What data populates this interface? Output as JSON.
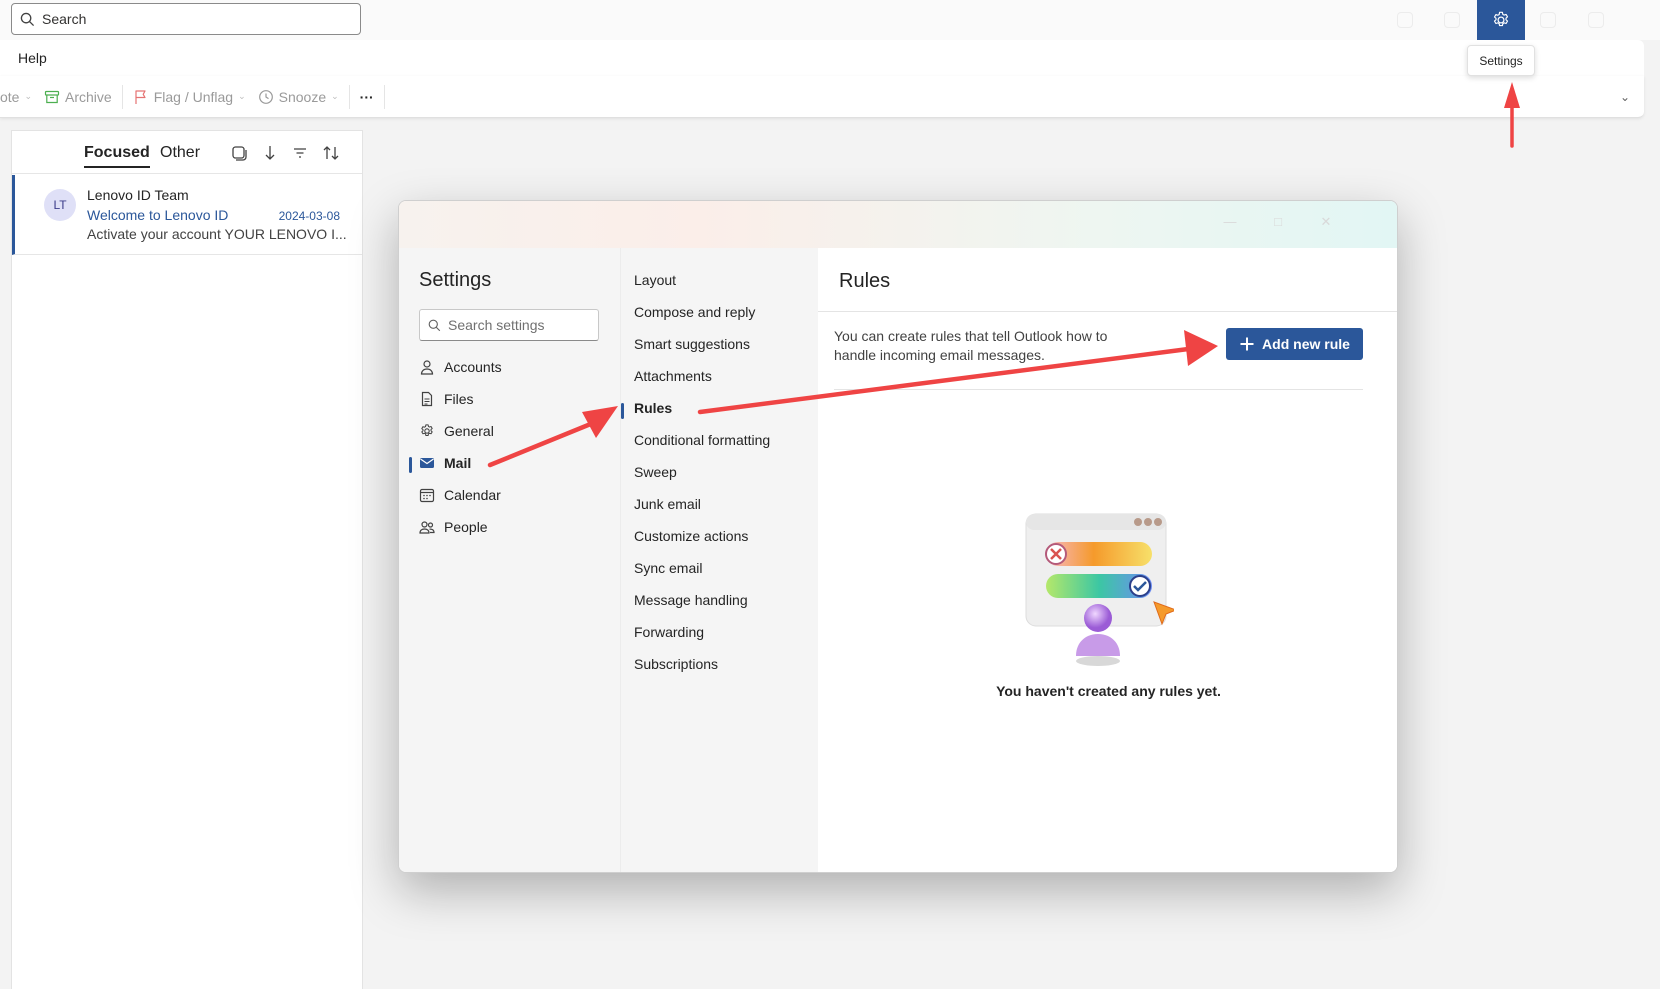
{
  "topbar": {
    "search_placeholder": "Search",
    "settings_icon": "gear-icon"
  },
  "tooltip": {
    "text": "Settings"
  },
  "menubar": {
    "help": "Help"
  },
  "toolbar": {
    "truncated_label": "ote",
    "archive": "Archive",
    "flag": "Flag / Unflag",
    "snooze": "Snooze",
    "more": "···"
  },
  "maillist": {
    "tab_focused": "Focused",
    "tab_other": "Other",
    "message": {
      "initials": "LT",
      "sender": "Lenovo ID Team",
      "subject": "Welcome to Lenovo ID",
      "date": "2024-03-08",
      "preview": "Activate your account YOUR LENOVO I..."
    }
  },
  "settings": {
    "title": "Settings",
    "search_placeholder": "Search settings",
    "categories": [
      {
        "label": "Accounts",
        "icon": "person-icon"
      },
      {
        "label": "Files",
        "icon": "file-icon"
      },
      {
        "label": "General",
        "icon": "gear-icon"
      },
      {
        "label": "Mail",
        "icon": "mail-icon",
        "selected": true
      },
      {
        "label": "Calendar",
        "icon": "calendar-icon"
      },
      {
        "label": "People",
        "icon": "people-icon"
      }
    ],
    "mail_sections": [
      "Layout",
      "Compose and reply",
      "Smart suggestions",
      "Attachments",
      "Rules",
      "Conditional formatting",
      "Sweep",
      "Junk email",
      "Customize actions",
      "Sync email",
      "Message handling",
      "Forwarding",
      "Subscriptions"
    ],
    "selected_section": "Rules",
    "pane": {
      "title": "Rules",
      "description": "You can create rules that tell Outlook how to handle incoming email messages.",
      "add_button": "Add new rule",
      "empty_text": "You haven't created any rules yet."
    }
  },
  "colors": {
    "accent": "#2b579a",
    "annotation": "#ef4444"
  }
}
